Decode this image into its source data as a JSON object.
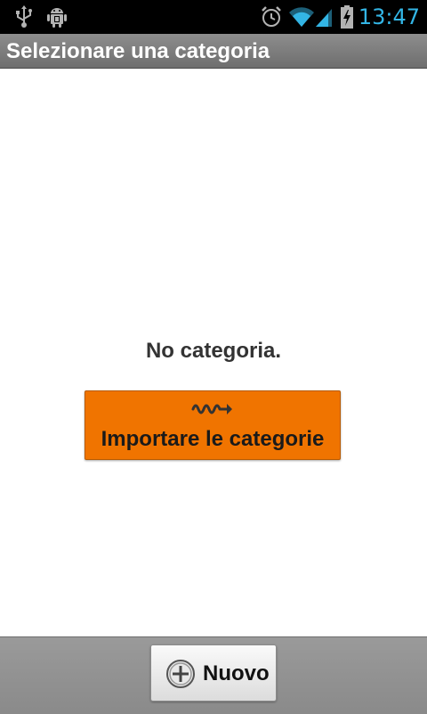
{
  "status_bar": {
    "time": "13:47",
    "icons": [
      "usb-icon",
      "android-debug-icon",
      "alarm-icon",
      "wifi-icon",
      "signal-icon",
      "battery-charging-icon"
    ],
    "time_color": "#33b5e5"
  },
  "title_bar": {
    "title": "Selezionare una categoria"
  },
  "main": {
    "empty_message": "No categoria.",
    "import_button_label": "Importare le categorie",
    "import_button_color": "#f07400",
    "import_icon": "import-wave-arrow-icon"
  },
  "bottom_bar": {
    "new_button_label": "Nuovo",
    "new_icon": "add-circle-icon"
  }
}
